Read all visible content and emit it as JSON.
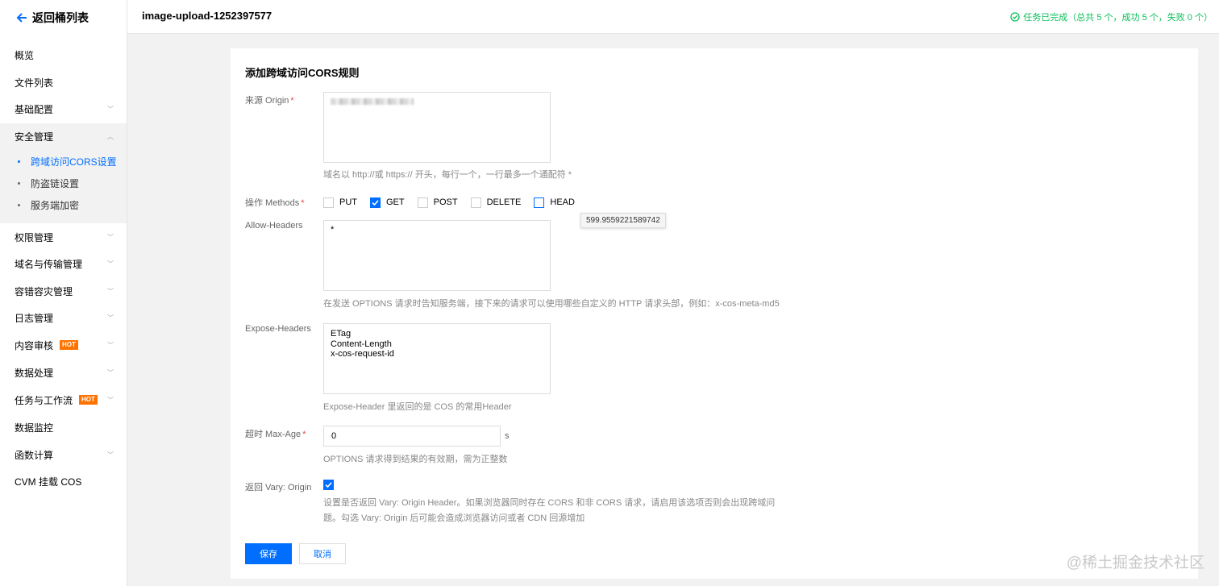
{
  "sidebar": {
    "back_label": "返回桶列表",
    "items": [
      {
        "label": "概览"
      },
      {
        "label": "文件列表"
      },
      {
        "label": "基础配置"
      },
      {
        "label": "安全管理"
      },
      {
        "label": "权限管理"
      },
      {
        "label": "域名与传输管理"
      },
      {
        "label": "容错容灾管理"
      },
      {
        "label": "日志管理"
      },
      {
        "label": "内容审核",
        "badge": "HOT"
      },
      {
        "label": "数据处理"
      },
      {
        "label": "任务与工作流",
        "badge": "HOT"
      },
      {
        "label": "数据监控"
      },
      {
        "label": "函数计算"
      },
      {
        "label": "CVM 挂载 COS"
      }
    ],
    "security_sub_items": [
      {
        "label": "跨域访问CORS设置",
        "active": true
      },
      {
        "label": "防盗链设置"
      },
      {
        "label": "服务端加密"
      }
    ]
  },
  "header": {
    "bucket_name": "image-upload-1252397577",
    "task_status": "任务已完成（总共 5 个，成功 5 个，失败 0 个）",
    "status_color": "#0abf5b"
  },
  "form": {
    "title": "添加跨域访问CORS规则",
    "origin": {
      "label": "来源 Origin",
      "hint": "域名以 http://或 https:// 开头，每行一个，一行最多一个通配符 *"
    },
    "methods": {
      "label": "操作 Methods",
      "options": [
        {
          "label": "PUT",
          "checked": false
        },
        {
          "label": "GET",
          "checked": true
        },
        {
          "label": "POST",
          "checked": false
        },
        {
          "label": "DELETE",
          "checked": false
        },
        {
          "label": "HEAD",
          "checked": false
        }
      ],
      "tooltip": "599.9559221589742"
    },
    "allow_headers": {
      "label": "Allow-Headers",
      "value": "*",
      "hint": "在发送 OPTIONS 请求时告知服务端，接下来的请求可以使用哪些自定义的 HTTP 请求头部，例如：x-cos-meta-md5"
    },
    "expose_headers": {
      "label": "Expose-Headers",
      "value": "ETag\nContent-Length\nx-cos-request-id",
      "hint": "Expose-Header 里返回的是 COS 的常用Header"
    },
    "max_age": {
      "label": "超时 Max-Age",
      "value": "0",
      "unit": "s",
      "hint": "OPTIONS 请求得到结果的有效期，需为正整数"
    },
    "vary": {
      "label": "返回 Vary: Origin",
      "checked": true,
      "hint_line1": "设置是否返回 Vary: Origin Header。如果浏览器同时存在 CORS 和非 CORS 请求，请启用该选项否则会出现跨域问",
      "hint_line2": "题。勾选 Vary: Origin 后可能会造成浏览器访问或者 CDN 回源增加"
    },
    "save_label": "保存",
    "cancel_label": "取消"
  },
  "watermark": "@稀土掘金技术社区",
  "colors": {
    "accent": "#006eff",
    "hot": "#ff7200"
  }
}
